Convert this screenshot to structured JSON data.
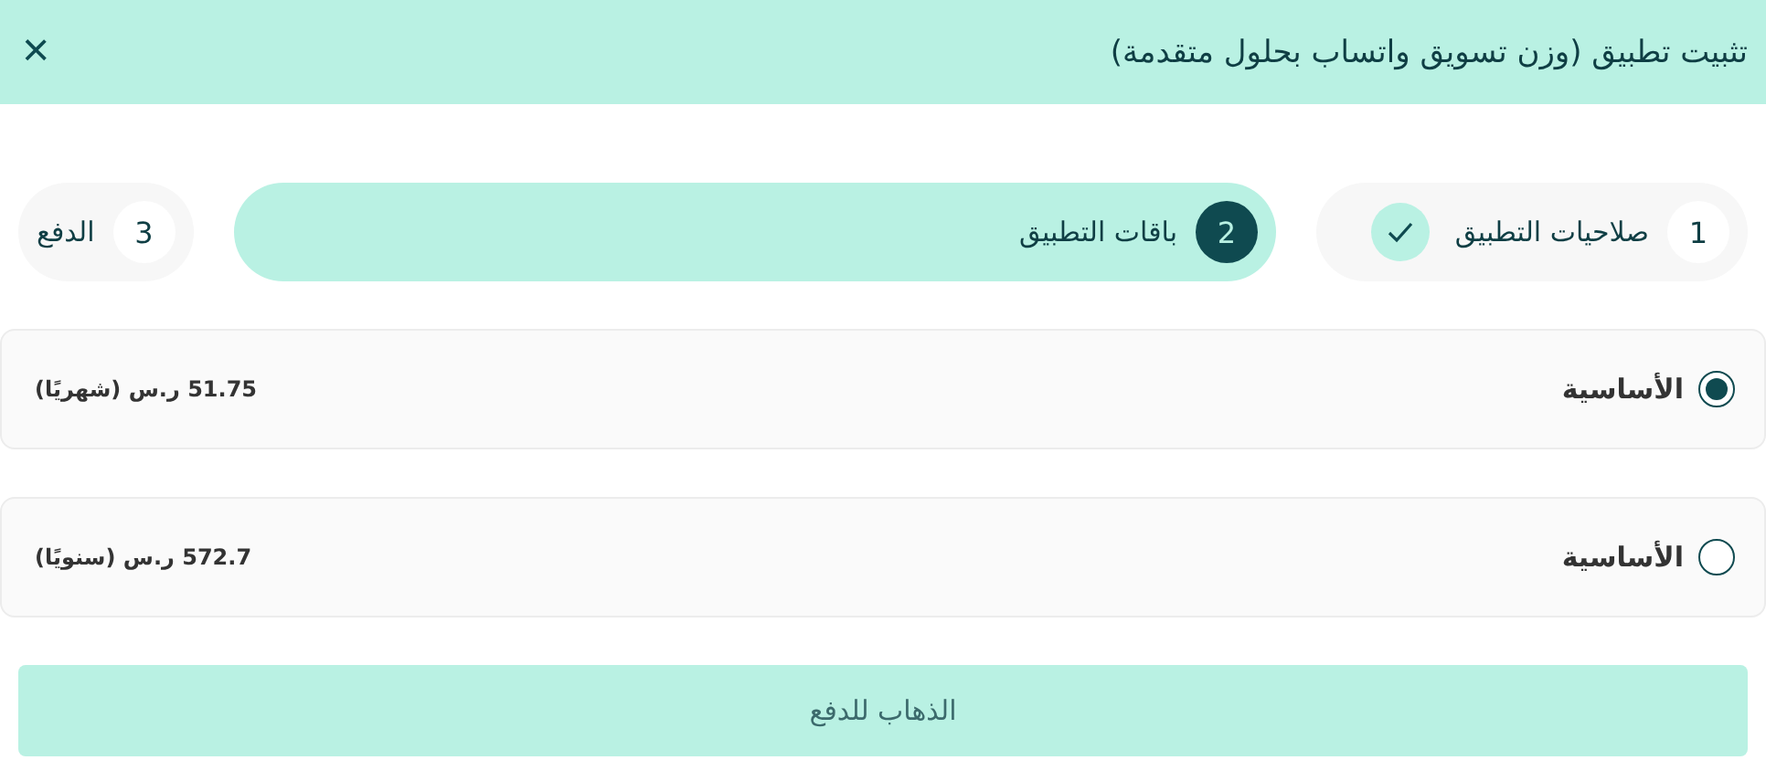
{
  "dialog": {
    "title": "تثبيت تطبيق (وزن تسويق واتساب بحلول متقدمة)",
    "close": "×"
  },
  "steps": [
    {
      "number": "1",
      "label": "صلاحيات التطبيق",
      "selected": false,
      "completed": true
    },
    {
      "number": "2",
      "label": "باقات التطبيق",
      "selected": true,
      "completed": false
    },
    {
      "number": "3",
      "label": "الدفع",
      "selected": false,
      "completed": false
    }
  ],
  "plans": [
    {
      "name": "الأساسية",
      "price": "51.75 ر.س (شهريًا)",
      "selected": true
    },
    {
      "name": "الأساسية",
      "price": "572.7 ر.س (سنويًا)",
      "selected": false
    }
  ],
  "submit_button": "الذهاب للدفع"
}
